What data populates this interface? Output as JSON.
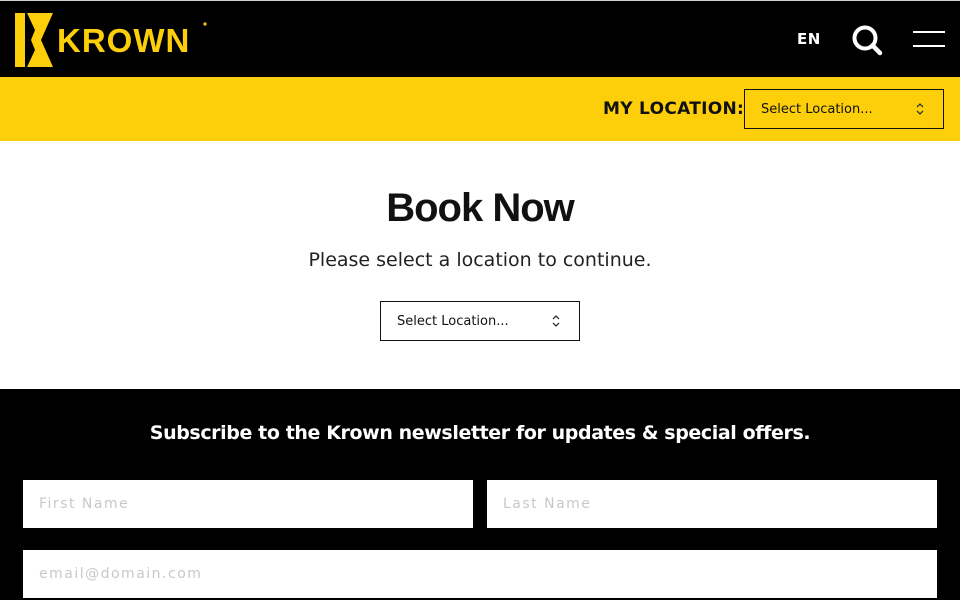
{
  "header": {
    "logo_text": "KROWN",
    "language": "EN"
  },
  "location_bar": {
    "label": "MY LOCATION:",
    "select_value": "Select Location..."
  },
  "main": {
    "title": "Book Now",
    "subtitle": "Please select a location to continue.",
    "select_value": "Select Location..."
  },
  "footer": {
    "newsletter_text": "Subscribe to the Krown newsletter for updates & special offers.",
    "first_name_placeholder": "First Name",
    "last_name_placeholder": "Last Name",
    "email_placeholder": "email@domain.com"
  },
  "colors": {
    "brand_yellow": "#fccf0a",
    "header_bg": "#000000"
  }
}
